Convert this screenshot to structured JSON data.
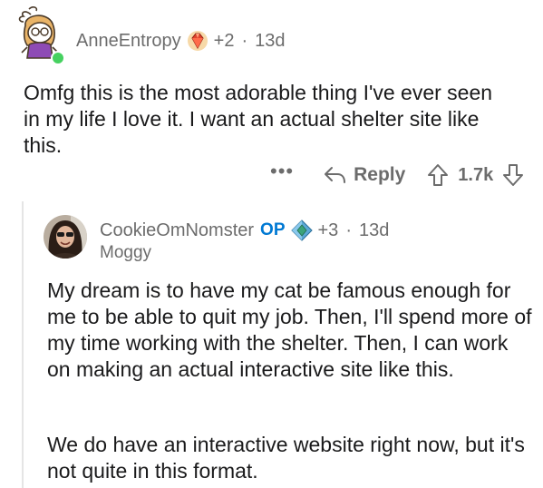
{
  "thread": {
    "top_comment": {
      "username": "AnneEntropy",
      "award_icon": "red-gem-award-icon",
      "karma": "+2",
      "separator": "·",
      "time": "13d",
      "body": "Omfg this is the most adorable thing I've ever seen in my life I love it. I want an actual shelter site like this.",
      "actions": {
        "more": "•••",
        "reply_label": "Reply",
        "score": "1.7k"
      },
      "avatar_icon": "snoo-avatar-icon",
      "online_color": "#46d160"
    },
    "reply_comment": {
      "username": "CookieOmNomster",
      "op_label": "OP",
      "award_icon": "blue-gem-award-icon",
      "karma": "+3",
      "separator": "·",
      "time": "13d",
      "flair": "Moggy",
      "body_paragraph_1": "My dream is to have my cat be famous enough for me to be able to quit my job. Then, I'll spend more of my time working with the shelter. Then, I can work on making an actual interactive site like this.",
      "body_paragraph_2": "We do have an interactive website right now, but it's not quite in this format.",
      "avatar_icon": "profile-photo-avatar"
    }
  },
  "colors": {
    "meta_gray": "#6c6c6c",
    "op_blue": "#0079d3",
    "text": "#1a1a1b",
    "thread_line": "#e5e5e5"
  }
}
